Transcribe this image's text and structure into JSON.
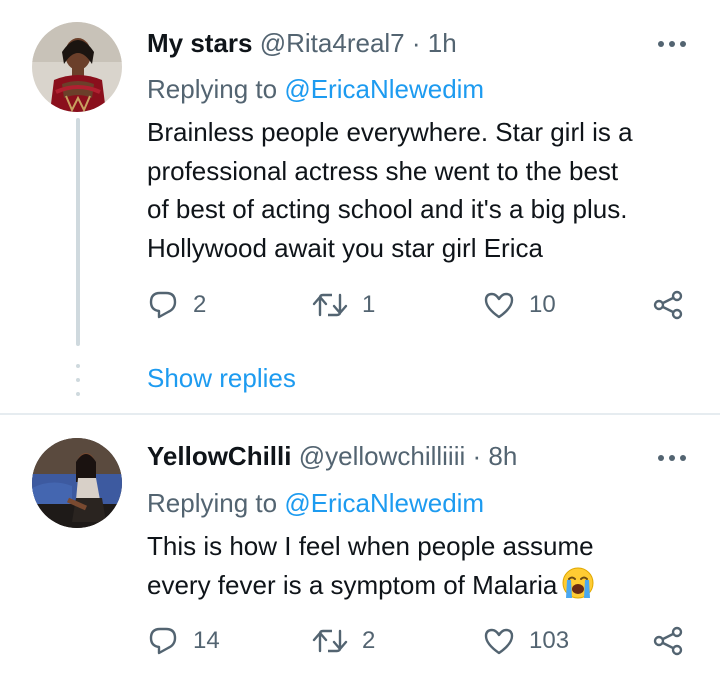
{
  "tweets": [
    {
      "name": "My stars",
      "handle": "@Rita4real7",
      "separator": "·",
      "time": "1h",
      "replying_prefix": "Replying to",
      "replying_mention": "@EricaNlewedim",
      "lines": [
        "Brainless people everywhere. Star girl is a",
        "professional actress she went to the best",
        "of best of acting school and it's a big plus.",
        "Hollywood await you star girl Erica"
      ],
      "reply_count": "2",
      "retweet_count": "1",
      "like_count": "10",
      "show_replies": "Show replies"
    },
    {
      "name": "YellowChilli",
      "handle": "@yellowchilliiii",
      "separator": "·",
      "time": "8h",
      "replying_prefix": "Replying to",
      "replying_mention": "@EricaNlewedim",
      "lines": [
        "This is how I feel when people assume",
        "every fever is a symptom of Malaria"
      ],
      "emoji": "loudly-crying-face",
      "reply_count": "14",
      "retweet_count": "2",
      "like_count": "103"
    }
  ],
  "icons": {
    "reply": "speech-bubble-icon",
    "retweet": "retweet-arrows-icon",
    "like": "heart-icon",
    "share": "share-nodes-icon",
    "more": "three-dots-icon"
  },
  "colors": {
    "link": "#1d9bf0",
    "secondary_text": "#536471",
    "thread_line": "#cfd9de"
  }
}
